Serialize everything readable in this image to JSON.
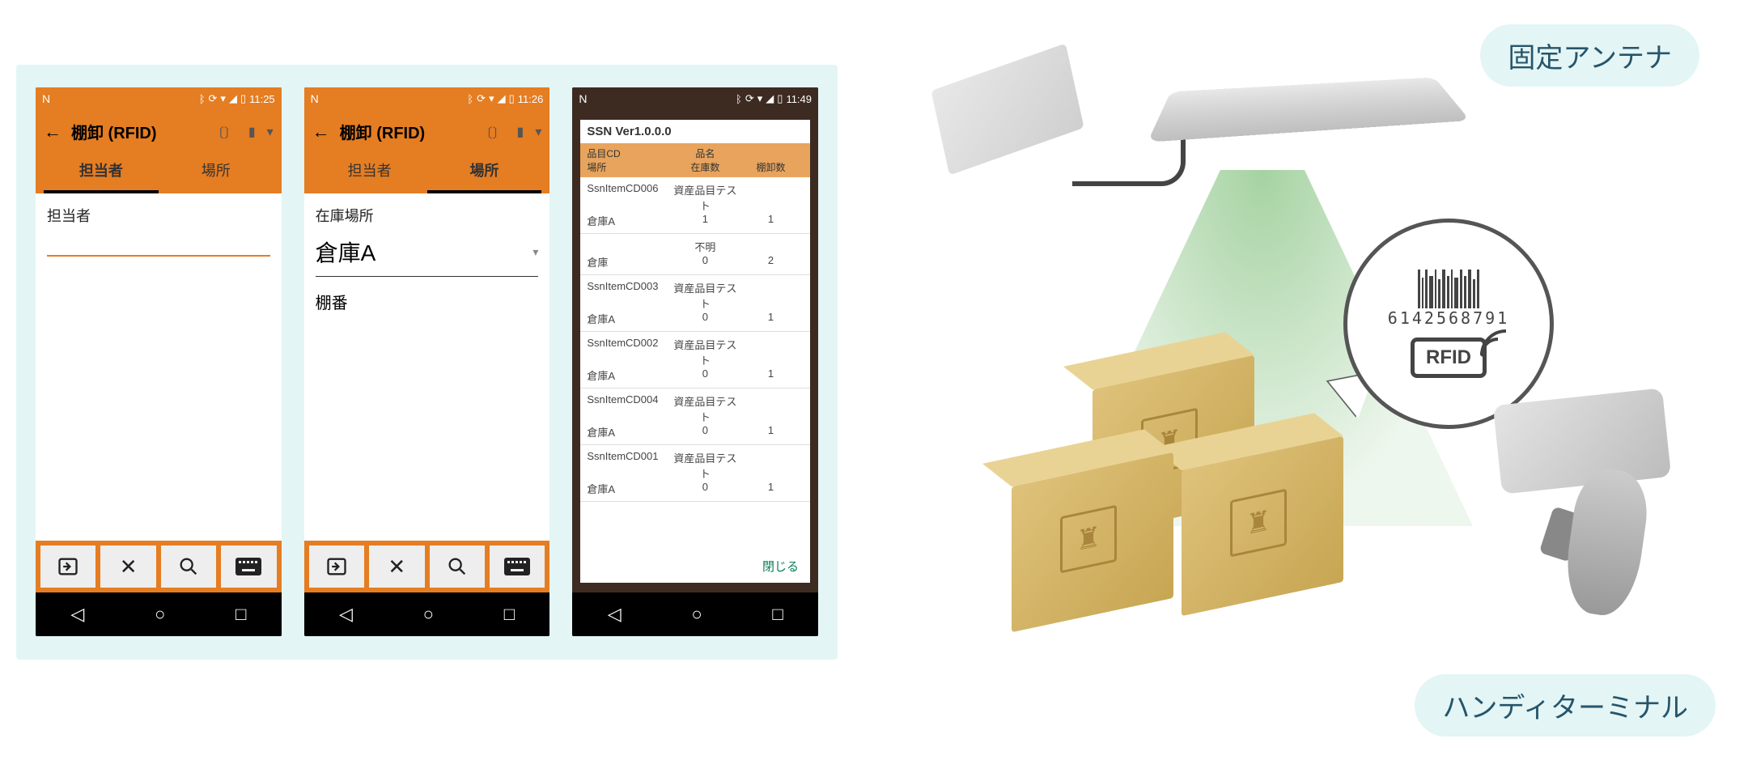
{
  "colors": {
    "accent": "#e57d22",
    "panel": "#e3f5f5",
    "text": "#26556b"
  },
  "phone1": {
    "time": "11:25",
    "title": "棚卸 (RFID)",
    "tabs": {
      "person": "担当者",
      "place": "場所",
      "active": "person"
    },
    "field_label": "担当者",
    "bottom_icons": [
      "enter-icon",
      "close-icon",
      "search-icon",
      "keyboard-icon"
    ]
  },
  "phone2": {
    "time": "11:26",
    "title": "棚卸 (RFID)",
    "tabs": {
      "person": "担当者",
      "place": "場所",
      "active": "place"
    },
    "location_label": "在庫場所",
    "location_value": "倉庫A",
    "shelf_label": "棚番"
  },
  "phone3": {
    "time": "11:49",
    "dialog_title": "SSN Ver1.0.0.0",
    "columns": {
      "row1": {
        "c1": "品目CD",
        "c2": "品名",
        "c3": ""
      },
      "row2": {
        "c1": "場所",
        "c2": "在庫数",
        "c3": "棚卸数"
      }
    },
    "rows": [
      {
        "code": "SsnItemCD006",
        "name": "資産品目テスト",
        "place": "倉庫A",
        "stock": "1",
        "count": "1"
      },
      {
        "code": "",
        "name": "不明",
        "place": "倉庫",
        "stock": "0",
        "count": "2"
      },
      {
        "code": "SsnItemCD003",
        "name": "資産品目テスト",
        "place": "倉庫A",
        "stock": "0",
        "count": "1"
      },
      {
        "code": "SsnItemCD002",
        "name": "資産品目テスト",
        "place": "倉庫A",
        "stock": "0",
        "count": "1"
      },
      {
        "code": "SsnItemCD004",
        "name": "資産品目テスト",
        "place": "倉庫A",
        "stock": "0",
        "count": "1"
      },
      {
        "code": "SsnItemCD001",
        "name": "資産品目テスト",
        "place": "倉庫A",
        "stock": "0",
        "count": "1"
      }
    ],
    "close_label": "閉じる"
  },
  "illustration": {
    "top_label": "固定アンテナ",
    "bottom_label": "ハンディターミナル",
    "barcode_number": "6142568791",
    "rfid_label": "RFID"
  }
}
